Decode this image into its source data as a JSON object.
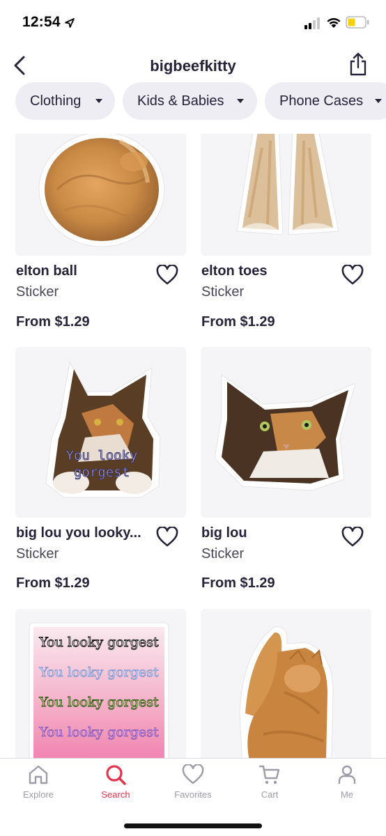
{
  "status_bar": {
    "time": "12:54",
    "battery_color": "#f5d10d"
  },
  "header": {
    "title": "bigbeefkitty",
    "back_icon": "chevron-left-icon",
    "share_icon": "share-icon"
  },
  "filters": [
    {
      "label": "Clothing"
    },
    {
      "label": "Kids & Babies"
    },
    {
      "label": "Phone Cases"
    }
  ],
  "products": [
    {
      "name": "elton ball",
      "type": "Sticker",
      "price": "From $1.29",
      "image": "curled-orange-cat"
    },
    {
      "name": "elton toes",
      "type": "Sticker",
      "price": "From $1.29",
      "image": "orange-cat-legs"
    },
    {
      "name": "big lou you looky...",
      "type": "Sticker",
      "price": "From $1.29",
      "image": "calico-cat-caption",
      "caption_lines": [
        "You looky",
        "gorgest"
      ]
    },
    {
      "name": "big lou",
      "type": "Sticker",
      "price": "From $1.29",
      "image": "calico-cat-face"
    },
    {
      "name": "",
      "type": "",
      "price": "",
      "image": "text-gradient-sticker",
      "caption_lines": [
        "You looky gorgest",
        "You looky gorgest",
        "You looky gorgest",
        "You looky gorgest"
      ]
    },
    {
      "name": "",
      "type": "",
      "price": "",
      "image": "curled-orange-cat-2"
    }
  ],
  "tabs": [
    {
      "label": "Explore",
      "icon": "home-icon",
      "active": false
    },
    {
      "label": "Search",
      "icon": "search-icon",
      "active": true
    },
    {
      "label": "Favorites",
      "icon": "heart-icon",
      "active": false
    },
    {
      "label": "Cart",
      "icon": "cart-icon",
      "active": false
    },
    {
      "label": "Me",
      "icon": "person-icon",
      "active": false
    }
  ],
  "colors": {
    "text": "#26223a",
    "active_tab": "#e4354e",
    "inactive_tab": "#9e9ba8",
    "chip_bg": "#eeedf3",
    "card_bg": "#f5f5f7"
  }
}
